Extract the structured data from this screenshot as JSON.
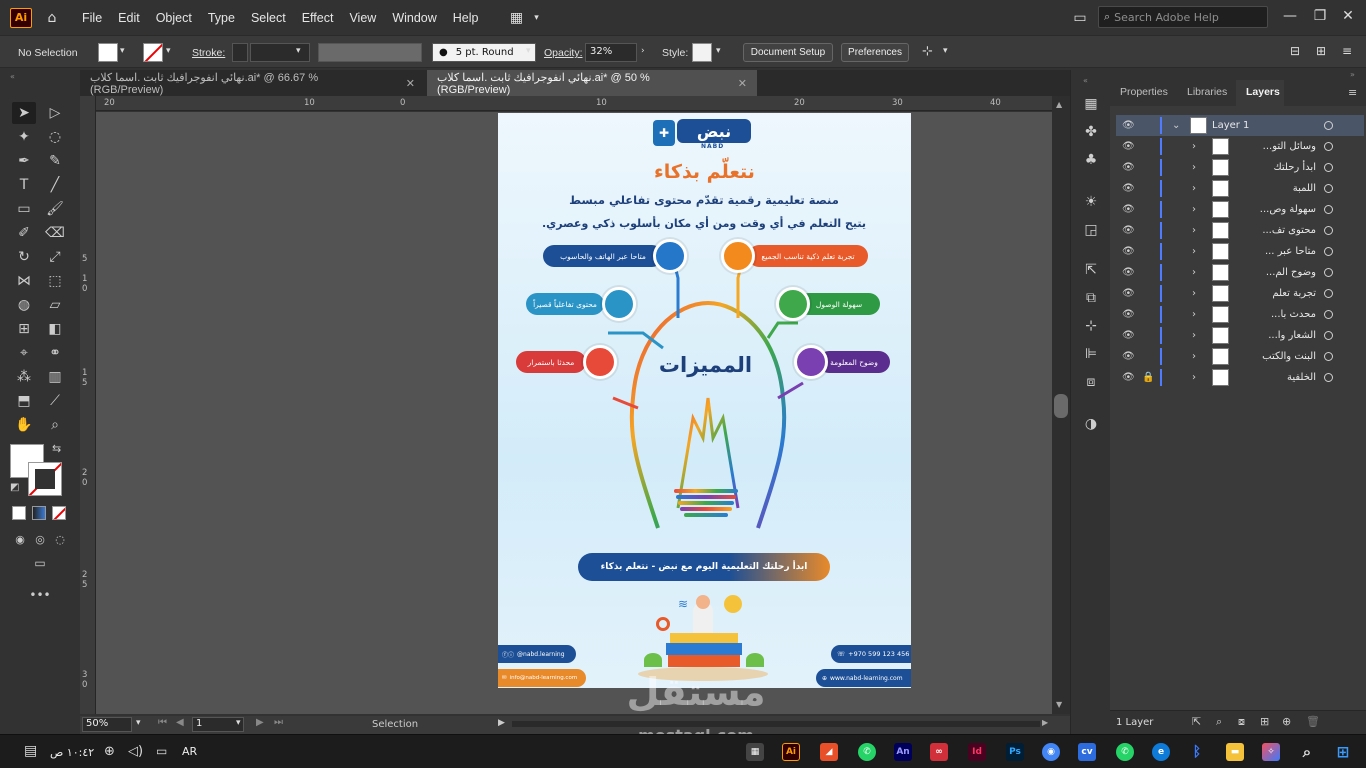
{
  "app": {
    "logo": "Ai"
  },
  "menu": [
    "File",
    "Edit",
    "Object",
    "Type",
    "Select",
    "Effect",
    "View",
    "Window",
    "Help"
  ],
  "help_search": {
    "placeholder": "Search Adobe Help"
  },
  "control": {
    "selection": "No Selection",
    "stroke_label": "Stroke:",
    "brush": "5 pt. Round",
    "opacity_label": "Opacity:",
    "opacity_value": "32%",
    "style_label": "Style:",
    "document_setup": "Document Setup",
    "preferences": "Preferences"
  },
  "tabs": [
    {
      "label": "نهائي انفوجرافيك ثابت .اسما كلاب.ai* @ 66.67 % (RGB/Preview)",
      "active": false
    },
    {
      "label": "نهائي انفوجرافيك ثابت .اسما كلاب.ai* @ 50 % (RGB/Preview)",
      "active": true
    }
  ],
  "ruler": {
    "h": [
      "20",
      "10",
      "0",
      "10",
      "20",
      "30",
      "40"
    ],
    "v": [
      "5",
      "1 0",
      "1 5",
      "2 0",
      "2 5",
      "3 0"
    ]
  },
  "status": {
    "zoom": "50%",
    "artboard": "1",
    "tool": "Selection"
  },
  "panel": {
    "tabs": [
      "Properties",
      "Libraries",
      "Layers"
    ],
    "active_tab": "Layers",
    "top_layer": "Layer 1",
    "sublayers": [
      "وسائل التو...",
      "ابدأ رحلتك",
      "اللمبة",
      "سهولة وص...",
      "محتوى تف...",
      "متاحا عبر ...",
      "وضوح الم...",
      "تجربة تعلم",
      "محدث با...",
      "الشعار وا...",
      "البنت والكتب",
      "الخلفية"
    ],
    "count": "1 Layer"
  },
  "poster": {
    "logo": "نبض",
    "logo_sub": "NABD",
    "headline": "نتعلّم بذكاء",
    "tagline1": "منصة تعليمية رقمية تقدّم محتوى تفاعلي مبسط",
    "tagline2": "يتيح التعلم في أي وقت ومن أي مكان بأسلوب ذكي وعصري.",
    "center": "المميزات",
    "features": [
      "متاحا عبر الهاتف والحاسوب",
      "تجربة تعلم ذكية تناسب الجميع",
      "محتوى تفاعلياً قصيراً",
      "سهولة الوصول",
      "محدثا باستمرار",
      "وضوح المعلومة"
    ],
    "cta": "ابدأ رحلتك التعليمية اليوم مع نبض - نتعلم بذكاء",
    "social": "@nabd.learning",
    "phone": "+970 599 123 456",
    "email": "info@nabd-learning.com",
    "web": "www.nabd-learning.com"
  },
  "taskbar": {
    "time": "١٠:٤٢ ص",
    "lang": "AR"
  },
  "watermark": {
    "text": "مستقل",
    "sub": "mostaql.com"
  },
  "colors": {
    "ui_bg": "#323232",
    "accent": "#4e7bff",
    "ai_orange": "#ff9a00"
  }
}
